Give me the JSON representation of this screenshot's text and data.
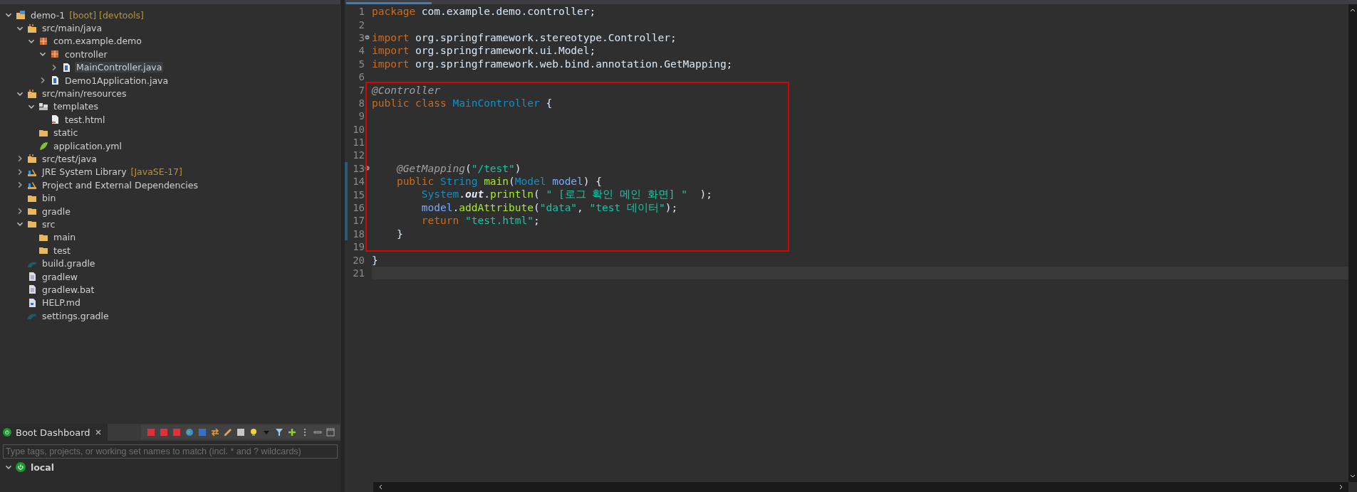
{
  "project_explorer": {
    "tree": [
      {
        "label": "demo-1",
        "decoration": "[boot] [devtools]",
        "kind": "project",
        "expanded": true,
        "selected": false,
        "children": [
          {
            "label": "src/main/java",
            "kind": "source-folder",
            "expanded": true,
            "selected": false,
            "children": [
              {
                "label": "com.example.demo",
                "kind": "package",
                "expanded": true,
                "selected": false,
                "children": [
                  {
                    "label": "controller",
                    "kind": "package",
                    "expanded": true,
                    "selected": false,
                    "children": [
                      {
                        "label": "MainController.java",
                        "kind": "java",
                        "expanded": false,
                        "selected": true
                      }
                    ]
                  },
                  {
                    "label": "Demo1Application.java",
                    "kind": "java",
                    "expanded": false,
                    "selected": false
                  }
                ]
              }
            ]
          },
          {
            "label": "src/main/resources",
            "kind": "source-folder",
            "expanded": true,
            "selected": false,
            "children": [
              {
                "label": "templates",
                "kind": "templates",
                "expanded": true,
                "selected": false,
                "children": [
                  {
                    "label": "test.html",
                    "kind": "html",
                    "selected": false
                  }
                ]
              },
              {
                "label": "static",
                "kind": "folder",
                "selected": false
              },
              {
                "label": "application.yml",
                "kind": "yml",
                "selected": false
              }
            ]
          },
          {
            "label": "src/test/java",
            "kind": "source-folder",
            "expanded": false,
            "selected": false
          },
          {
            "label": "JRE System Library",
            "decoration": "[JavaSE-17]",
            "kind": "library",
            "expanded": false,
            "selected": false
          },
          {
            "label": "Project and External Dependencies",
            "kind": "library",
            "expanded": false,
            "selected": false
          },
          {
            "label": "bin",
            "kind": "folder",
            "selected": false
          },
          {
            "label": "gradle",
            "kind": "folder",
            "expanded": false,
            "selected": false
          },
          {
            "label": "src",
            "kind": "folder",
            "expanded": true,
            "selected": false,
            "children": [
              {
                "label": "main",
                "kind": "folder",
                "selected": false
              },
              {
                "label": "test",
                "kind": "folder",
                "selected": false
              }
            ]
          },
          {
            "label": "build.gradle",
            "kind": "gradle",
            "selected": false
          },
          {
            "label": "gradlew",
            "kind": "file",
            "selected": false
          },
          {
            "label": "gradlew.bat",
            "kind": "file",
            "selected": false
          },
          {
            "label": "HELP.md",
            "kind": "md",
            "selected": false
          },
          {
            "label": "settings.gradle",
            "kind": "gradle",
            "selected": false
          }
        ]
      }
    ]
  },
  "boot_dashboard": {
    "tab": {
      "label": "Boot Dashboard"
    },
    "search": {
      "placeholder": "Type tags, projects, or working set names to match (incl. * and ? wildcards)"
    },
    "targets": [
      {
        "label": "local",
        "expanded": true
      }
    ]
  },
  "editor": {
    "lines": [
      {
        "n": "1",
        "kind": "top",
        "tokens": [
          {
            "kind": "kw",
            "t": "package"
          },
          {
            "kind": "plain",
            "t": " com.example.demo.controller;"
          }
        ]
      },
      {
        "n": "2"
      },
      {
        "n": "3",
        "kind": "top",
        "fold": true,
        "tokens": [
          {
            "kind": "kw",
            "t": "import"
          },
          {
            "kind": "plain",
            "t": " org.springframework.stereotype.Controller;"
          }
        ]
      },
      {
        "n": "4",
        "kind": "top",
        "tokens": [
          {
            "kind": "kw",
            "t": "import"
          },
          {
            "kind": "plain",
            "t": " org.springframework.ui.Model;"
          }
        ]
      },
      {
        "n": "5",
        "kind": "top",
        "tokens": [
          {
            "kind": "kw",
            "t": "import"
          },
          {
            "kind": "plain",
            "t": " org.springframework.web.bind.annotation.GetMapping;"
          }
        ]
      },
      {
        "n": "6"
      },
      {
        "n": "7",
        "kind": "top",
        "boxed": true,
        "tokens": [
          {
            "kind": "ann",
            "t": "@Controller"
          }
        ]
      },
      {
        "n": "8",
        "kind": "top",
        "boxed": true,
        "tokens": [
          {
            "kind": "kw",
            "t": "public class "
          },
          {
            "kind": "type",
            "t": "MainController"
          },
          {
            "kind": "plain",
            "t": " {"
          }
        ]
      },
      {
        "n": "9",
        "boxed": true
      },
      {
        "n": "10",
        "boxed": true
      },
      {
        "n": "11",
        "boxed": true
      },
      {
        "n": "12",
        "boxed": true
      },
      {
        "n": "13",
        "kind": "member",
        "boxed": true,
        "fold": true,
        "changed": true,
        "tokens": [
          {
            "kind": "ann",
            "t": "@GetMapping"
          },
          {
            "kind": "plain",
            "t": "("
          },
          {
            "kind": "string",
            "t": "\"/test\""
          },
          {
            "kind": "plain",
            "t": ")"
          }
        ]
      },
      {
        "n": "14",
        "kind": "member",
        "boxed": true,
        "changed": true,
        "tokens": [
          {
            "kind": "kw",
            "t": "public "
          },
          {
            "kind": "type",
            "t": "String "
          },
          {
            "kind": "method",
            "t": "main"
          },
          {
            "kind": "plain",
            "t": "("
          },
          {
            "kind": "type",
            "t": "Model "
          },
          {
            "kind": "param",
            "t": "model"
          },
          {
            "kind": "plain",
            "t": ") {"
          }
        ]
      },
      {
        "n": "15",
        "kind": "body",
        "boxed": true,
        "changed": true,
        "tokens": [
          {
            "kind": "type",
            "t": "System"
          },
          {
            "kind": "plain",
            "t": "."
          },
          {
            "kind": "field",
            "t": "out"
          },
          {
            "kind": "plain",
            "t": "."
          },
          {
            "kind": "method",
            "t": "println"
          },
          {
            "kind": "plain",
            "t": "( "
          },
          {
            "kind": "string",
            "t": "\" [로그 확인 메인 화면] \""
          },
          {
            "kind": "plain",
            "t": "  );"
          }
        ]
      },
      {
        "n": "16",
        "kind": "body",
        "boxed": true,
        "changed": true,
        "tokens": [
          {
            "kind": "param",
            "t": "model"
          },
          {
            "kind": "plain",
            "t": "."
          },
          {
            "kind": "method",
            "t": "addAttribute"
          },
          {
            "kind": "plain",
            "t": "("
          },
          {
            "kind": "string",
            "t": "\"data\""
          },
          {
            "kind": "plain",
            "t": ", "
          },
          {
            "kind": "string",
            "t": "\"test 데이터\""
          },
          {
            "kind": "plain",
            "t": ");"
          }
        ]
      },
      {
        "n": "17",
        "kind": "body",
        "boxed": true,
        "changed": true,
        "tokens": [
          {
            "kind": "kw",
            "t": "return "
          },
          {
            "kind": "string",
            "t": "\"test.html\""
          },
          {
            "kind": "plain",
            "t": ";"
          }
        ]
      },
      {
        "n": "18",
        "kind": "member",
        "boxed": true,
        "changed": true,
        "tokens": [
          {
            "kind": "plain",
            "t": "}"
          }
        ]
      },
      {
        "n": "19",
        "boxed": true
      },
      {
        "n": "20",
        "kind": "top",
        "tokens": [
          {
            "kind": "plain",
            "t": "}"
          }
        ]
      },
      {
        "n": "21",
        "current": true
      }
    ]
  }
}
